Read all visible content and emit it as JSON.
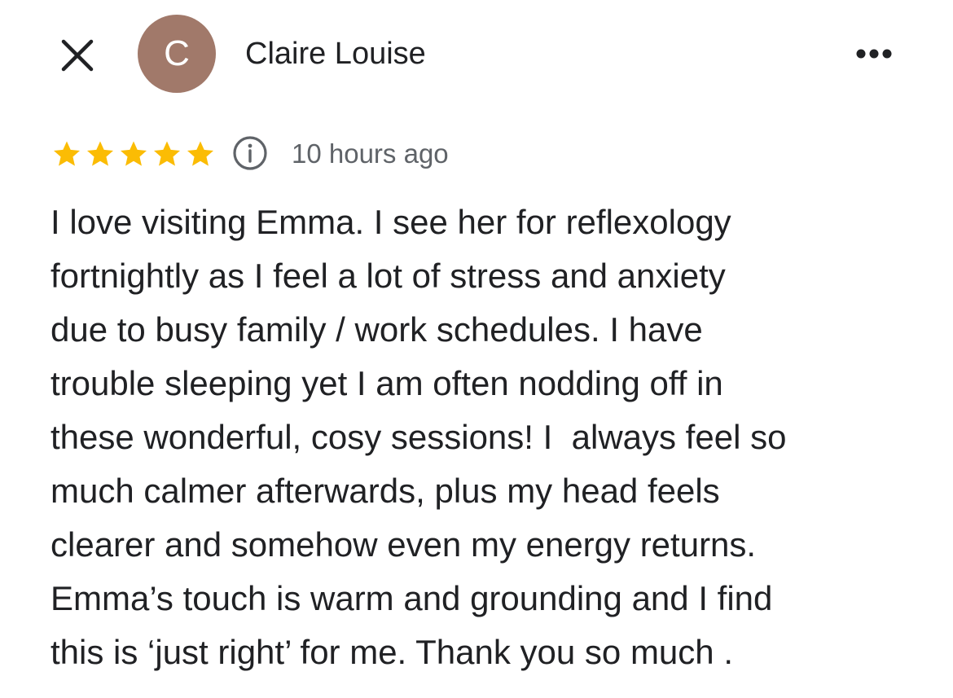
{
  "header": {
    "close_icon": "close-icon",
    "avatar_letter": "C",
    "avatar_color": "#a1796a",
    "reviewer_name": "Claire Louise",
    "more_icon": "more-horizontal-icon"
  },
  "review": {
    "rating": 5,
    "max_rating": 5,
    "star_color": "#fbbc04",
    "info_icon": "info-icon",
    "time": "10 hours ago",
    "text": "I love visiting Emma. I see her for reflexology\nfortnightly as I feel a lot of stress and anxiety\ndue to busy family / work schedules. I have\ntrouble sleeping yet I am often nodding off in\nthese wonderful, cosy sessions! I  always feel so\nmuch calmer afterwards, plus my head feels\nclearer and somehow even my energy returns.\nEmma’s touch is warm and grounding and I find\nthis is ‘just right’ for me. Thank you so much ."
  }
}
